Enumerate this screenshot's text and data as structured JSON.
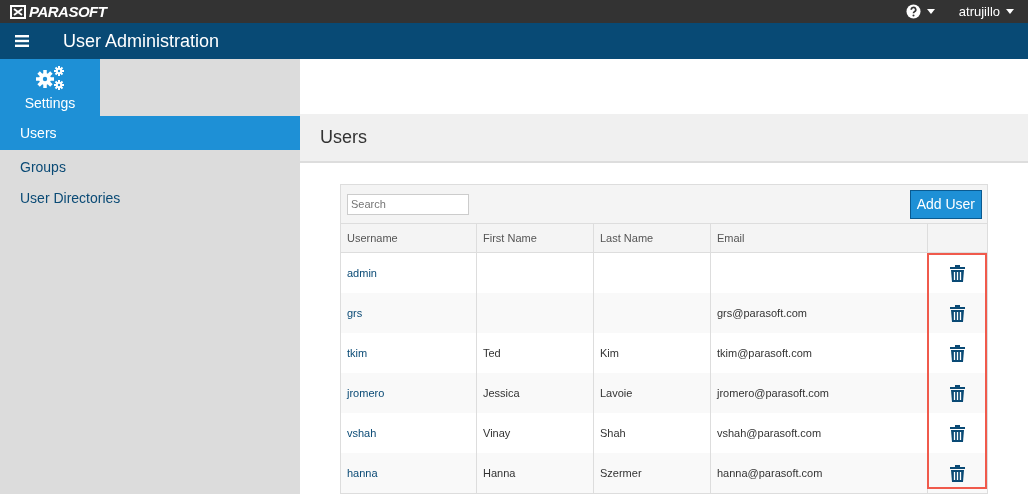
{
  "top_bar": {
    "logo": "PARASOFT",
    "user": "atrujillo"
  },
  "header": {
    "title": "User Administration"
  },
  "sidebar": {
    "tile": {
      "label": "Settings",
      "selected": true
    },
    "items": [
      {
        "label": "Users",
        "selected": true
      },
      {
        "label": "Groups",
        "selected": false
      },
      {
        "label": "User Directories",
        "selected": false
      }
    ]
  },
  "page": {
    "title": "Users"
  },
  "table": {
    "search": {
      "placeholder": "Search"
    },
    "add_button": "Add User",
    "delete_column_highlighted": true,
    "columns": [
      "Username",
      "First Name",
      "Last Name",
      "Email"
    ],
    "rows": [
      [
        "admin",
        "",
        "",
        ""
      ],
      [
        "grs",
        "",
        "",
        "grs@parasoft.com"
      ],
      [
        "tkim",
        "Ted",
        "Kim",
        "tkim@parasoft.com"
      ],
      [
        "jromero",
        "Jessica",
        "Lavoie",
        "jromero@parasoft.com"
      ],
      [
        "vshah",
        "Vinay",
        "Shah",
        "vshah@parasoft.com"
      ],
      [
        "hanna",
        "Hanna",
        "Szermer",
        "hanna@parasoft.com"
      ]
    ]
  }
}
